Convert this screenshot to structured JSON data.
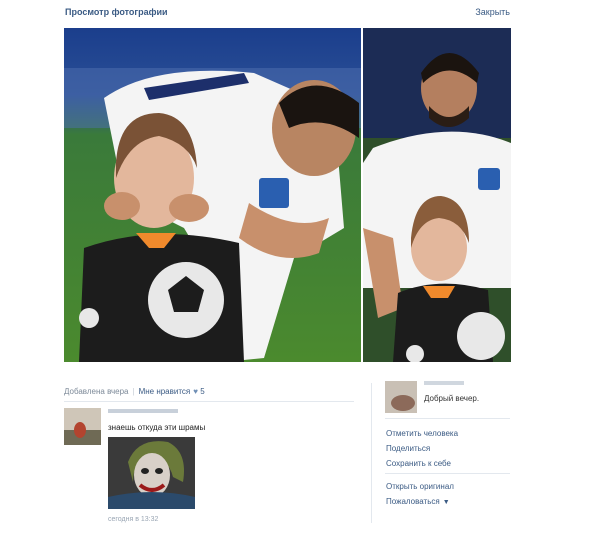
{
  "header": {
    "title": "Просмотр фотографии",
    "close_label": "Закрыть"
  },
  "meta": {
    "added": "Добавлена вчера",
    "like_label": "Мне нравится",
    "like_icon": "heart-icon",
    "like_count": "5"
  },
  "comment": {
    "text": "знаешь откуда эти шрамы",
    "time": "сегодня в 13:32"
  },
  "side": {
    "caption": "Добрый вечер.",
    "actions": [
      "Отметить человека",
      "Поделиться",
      "Сохранить к себе",
      "Открыть оригинал",
      "Пожаловаться"
    ]
  },
  "colors": {
    "link": "#3b5b84",
    "muted": "#7d8a99",
    "divider": "#e3e8ee"
  }
}
